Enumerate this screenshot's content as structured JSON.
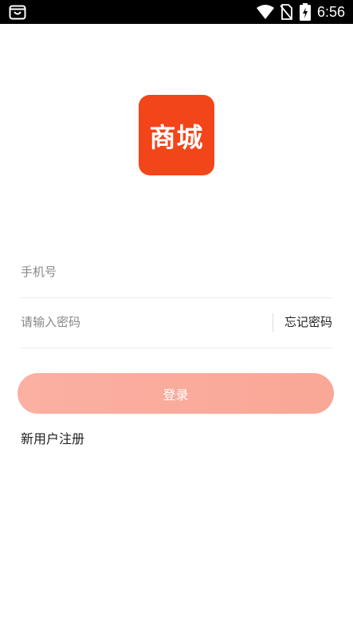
{
  "status_bar": {
    "time": "6:56",
    "icons": [
      "shopping-bag-icon",
      "wifi-icon",
      "no-sim-icon",
      "battery-charging-icon"
    ]
  },
  "logo": {
    "text": "商城",
    "color": "#f2451a"
  },
  "form": {
    "phone_placeholder": "手机号",
    "password_placeholder": "请输入密码",
    "forgot_label": "忘记密码"
  },
  "login_button": {
    "label": "登录",
    "color": "#fbb0a2"
  },
  "register_label": "新用户注册"
}
